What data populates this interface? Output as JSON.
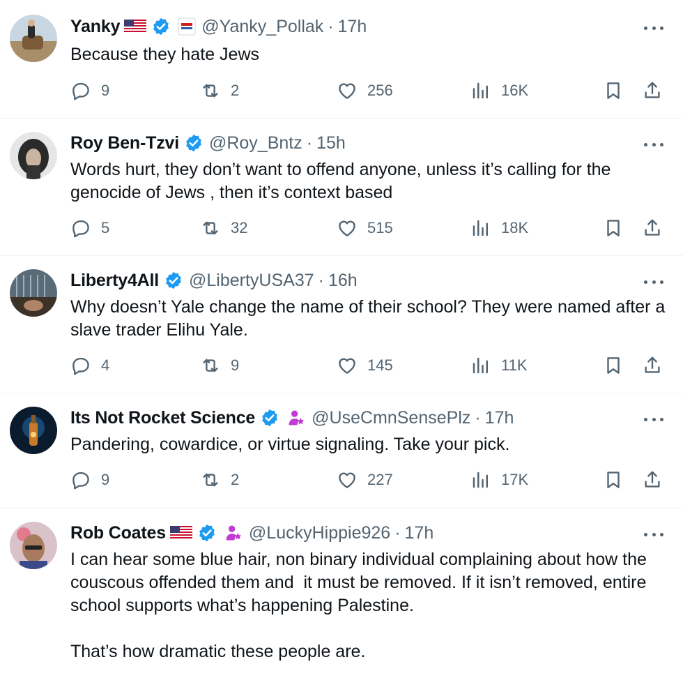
{
  "tweets": [
    {
      "name": "Yanky",
      "handle": "@Yanky_Pollak",
      "time": "17h",
      "text": "Because they hate Jews",
      "replies": "9",
      "reposts": "2",
      "likes": "256",
      "views": "16K",
      "badges": [
        "us-flag",
        "verified",
        "affiliate-news-badge"
      ]
    },
    {
      "name": "Roy Ben-Tzvi",
      "handle": "@Roy_Bntz",
      "time": "15h",
      "text": "Words hurt, they don’t want to offend anyone, unless it’s calling for the genocide of Jews , then it’s context based",
      "replies": "5",
      "reposts": "32",
      "likes": "515",
      "views": "18K",
      "badges": [
        "verified"
      ]
    },
    {
      "name": "Liberty4All",
      "handle": "@LibertyUSA37",
      "time": "16h",
      "text": "Why doesn’t Yale change the name of their school? They were named after a slave trader Elihu Yale.",
      "replies": "4",
      "reposts": "9",
      "likes": "145",
      "views": "11K",
      "badges": [
        "verified"
      ]
    },
    {
      "name": "Its Not Rocket Science",
      "handle": "@UseCmnSensePlz",
      "time": "17h",
      "text": "Pandering, cowardice, or virtue signaling. Take your pick.",
      "replies": "9",
      "reposts": "2",
      "likes": "227",
      "views": "17K",
      "badges": [
        "verified",
        "person-star-emoji"
      ]
    },
    {
      "name": "Rob Coates",
      "handle": "@LuckyHippie926",
      "time": "17h",
      "text": "I can hear some blue hair, non binary individual complaining about how the couscous offended them and  it must be removed. If it isn’t removed, entire school supports what’s happening Palestine.\n\nThat’s how dramatic these people are.",
      "badges": [
        "us-flag",
        "verified",
        "person-star-emoji"
      ]
    }
  ],
  "colors": {
    "text": "#0f1419",
    "secondary": "#536471",
    "verified": "#1d9bf0",
    "divider": "#eff3f4"
  },
  "separator": "·"
}
